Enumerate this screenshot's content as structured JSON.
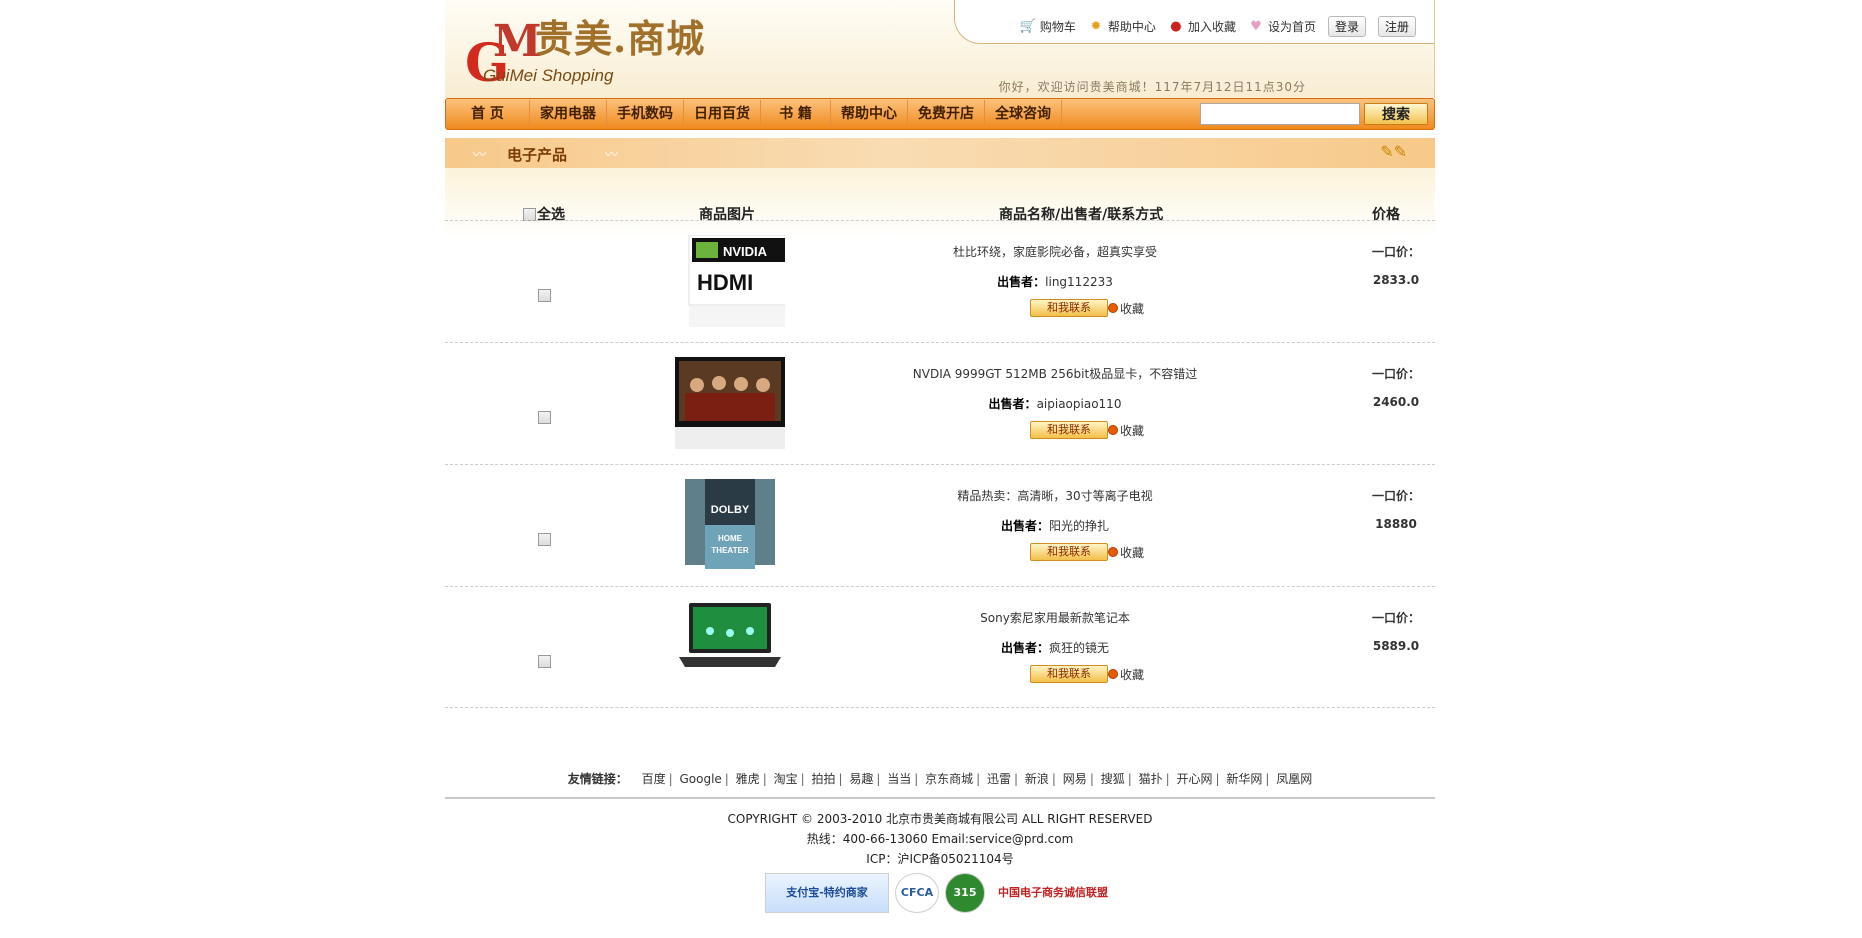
{
  "brand": {
    "name_cn": "贵美.商城",
    "name_en": "GuiMei Shopping"
  },
  "top_links": [
    {
      "icon": "cart-icon",
      "label": "购物车"
    },
    {
      "icon": "help-icon",
      "label": "帮助中心"
    },
    {
      "icon": "favorite-icon",
      "label": "加入收藏"
    },
    {
      "icon": "home-icon",
      "label": "设为首页"
    }
  ],
  "auth": {
    "login": "登录",
    "register": "注册"
  },
  "welcome": "你好，欢迎访问贵美商城！117年7月12日11点30分",
  "nav": [
    "首  页",
    "家用电器",
    "手机数码",
    "日用百货",
    "书  籍",
    "帮助中心",
    "免费开店",
    "全球咨询"
  ],
  "search": {
    "placeholder": "",
    "button": "搜索"
  },
  "section": {
    "title": "电子产品"
  },
  "table": {
    "select_all": "全选",
    "col_image": "商品图片",
    "col_info": "商品名称/出售者/联系方式",
    "col_price": "价格"
  },
  "products": [
    {
      "name": "杜比环绕，家庭影院必备，超真实享受",
      "seller_label": "出售者：",
      "seller": "ling112233",
      "contact": "和我联系",
      "fav": "收藏",
      "price_label": "一口价：",
      "price": "2833.0",
      "image_text": "NVIDIA HDMI"
    },
    {
      "name": "NVDIA 9999GT 512MB 256bit极品显卡，不容错过",
      "seller_label": "出售者：",
      "seller": "aipiaopiao110",
      "contact": "和我联系",
      "fav": "收藏",
      "price_label": "一口价：",
      "price": "2460.0",
      "image_text": ""
    },
    {
      "name": "精品热卖：高清晰，30寸等离子电视",
      "seller_label": "出售者：",
      "seller": "阳光的挣扎",
      "contact": "和我联系",
      "fav": "收藏",
      "price_label": "一口价：",
      "price": "18880",
      "image_text": "DOLBY HOME THEATER"
    },
    {
      "name": "Sony索尼家用最新款笔记本",
      "seller_label": "出售者：",
      "seller": "疯狂的镜无",
      "contact": "和我联系",
      "fav": "收藏",
      "price_label": "一口价：",
      "price": "5889.0",
      "image_text": ""
    }
  ],
  "friend_links": {
    "label": "友情链接：",
    "items": [
      "百度",
      "Google",
      "雅虎",
      "淘宝",
      "拍拍",
      "易趣",
      "当当",
      "京东商城",
      "迅雷",
      "新浪",
      "网易",
      "搜狐",
      "猫扑",
      "开心网",
      "新华网",
      "凤凰网"
    ]
  },
  "footer": {
    "copyright": "COPYRIGHT © 2003-2010 北京市贵美商城有限公司 ALL RIGHT RESERVED",
    "hotline": "热线：400-66-13060 Email:service@prd.com",
    "icp": "ICP：沪ICP备05021104号",
    "badges": [
      "支付宝-特约商家",
      "CFCA",
      "315",
      "中国电子商务诚信联盟"
    ]
  },
  "colors": {
    "nav_start": "#fcc27c",
    "nav_end": "#f08a1e",
    "brand_red": "#d32a1e",
    "brand_gold": "#a1702b"
  }
}
